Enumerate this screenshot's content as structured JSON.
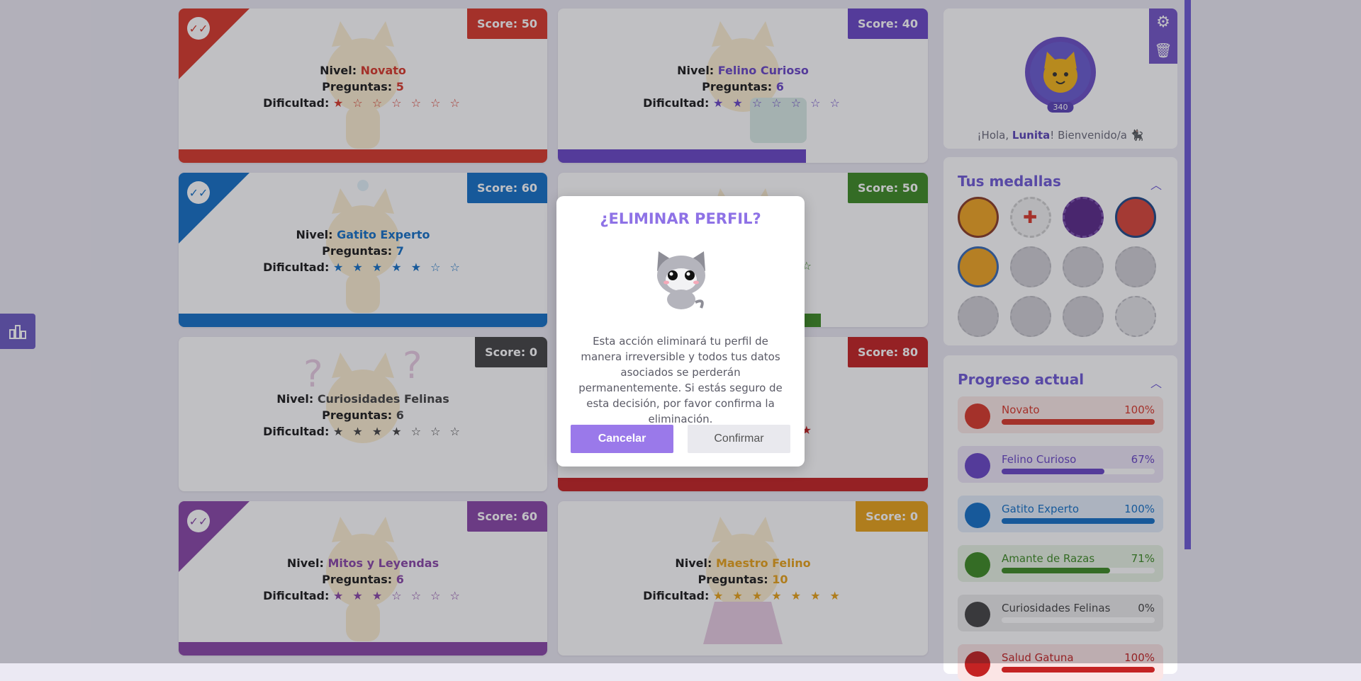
{
  "levels": [
    {
      "name": "Novato",
      "questions": "5",
      "score": "Score: 50",
      "color": "#d83a2c",
      "done": true,
      "progress": 100,
      "stars": "★ ☆ ☆ ☆ ☆ ☆ ☆"
    },
    {
      "name": "Felino Curioso",
      "questions": "6",
      "score": "Score: 40",
      "color": "#6a47c6",
      "done": false,
      "progress": 67,
      "stars": "★ ★ ☆ ☆ ☆ ☆ ☆"
    },
    {
      "name": "Gatito Experto",
      "questions": "7",
      "score": "Score: 60",
      "color": "#1571c6",
      "done": true,
      "progress": 100,
      "stars": "★ ★ ★ ★ ★ ☆ ☆"
    },
    {
      "name": "",
      "questions": "",
      "score": "Score: 50",
      "color": "#3e8b25",
      "done": false,
      "progress": 71,
      "stars": "☆"
    },
    {
      "name": "Curiosidades Felinas",
      "questions": "6",
      "score": "Score: 0",
      "color": "#444444",
      "done": false,
      "progress": 0,
      "stars": "★ ★ ★ ★ ☆ ☆ ☆"
    },
    {
      "name": "",
      "questions": "",
      "score": "Score: 80",
      "color": "#c42323",
      "done": false,
      "progress": 100,
      "stars": "★"
    },
    {
      "name": "Mitos y Leyendas",
      "questions": "6",
      "score": "Score: 60",
      "color": "#8a47a8",
      "done": true,
      "progress": 100,
      "stars": "★ ★ ★ ☆ ☆ ☆ ☆"
    },
    {
      "name": "Maestro Felino",
      "questions": "10",
      "score": "Score: 0",
      "color": "#e8a21a",
      "done": false,
      "progress": 0,
      "stars": "★ ★ ★ ★ ★ ★ ★"
    }
  ],
  "labels": {
    "level": "Nivel: ",
    "questions": "Preguntas: ",
    "difficulty": "Dificultad: "
  },
  "profile": {
    "score": "340",
    "greeting_pre": "¡Hola, ",
    "username": "Lunita",
    "greeting_post": "! Bienvenido/a ",
    "greeting_emoji": "🐈‍⬛"
  },
  "medals": {
    "title": "Tus medallas"
  },
  "progress": {
    "title": "Progreso actual",
    "rows": [
      {
        "name": "Novato",
        "pct": "100%",
        "value": 100,
        "color": "#d83a2c",
        "bg": "#fbe9e7"
      },
      {
        "name": "Felino Curioso",
        "pct": "67%",
        "value": 67,
        "color": "#6a47c6",
        "bg": "#ede7f7"
      },
      {
        "name": "Gatito Experto",
        "pct": "100%",
        "value": 100,
        "color": "#1571c6",
        "bg": "#e3eefa"
      },
      {
        "name": "Amante de Razas",
        "pct": "71%",
        "value": 71,
        "color": "#3e8b25",
        "bg": "#e8f3e3"
      },
      {
        "name": "Curiosidades Felinas",
        "pct": "0%",
        "value": 0,
        "color": "#444444",
        "bg": "#ececec"
      },
      {
        "name": "Salud Gatuna",
        "pct": "100%",
        "value": 100,
        "color": "#c42323",
        "bg": "#fbe5e5"
      }
    ]
  },
  "modal": {
    "title": "¿ELIMINAR PERFIL?",
    "message": "Esta acción eliminará tu perfil de manera irreversible y todos tus datos asociados se perderán permanentemente. Si estás seguro de esta decisión, por favor confirma la eliminación.",
    "cancel": "Cancelar",
    "confirm": "Confirmar"
  }
}
